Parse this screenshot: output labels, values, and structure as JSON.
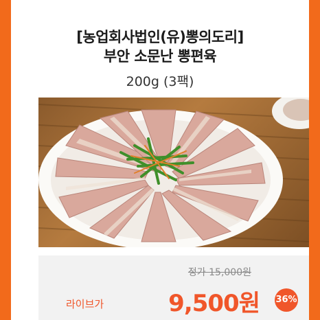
{
  "product": {
    "title_line1": "[농업회사법인(유)뽕의도리]",
    "title_line2": "부안 소문난 뽕편육",
    "subtitle": "200g (3팩)"
  },
  "image": {
    "icon": "sliced-pressed-pork-platter-photo"
  },
  "price": {
    "original": "정가 15,000원",
    "live_label": "라이브가",
    "sale": "9,500원",
    "discount": "36%"
  },
  "colors": {
    "accent": "#f26a1b",
    "price": "#f0562a",
    "price_box": "#f2f2f2"
  }
}
